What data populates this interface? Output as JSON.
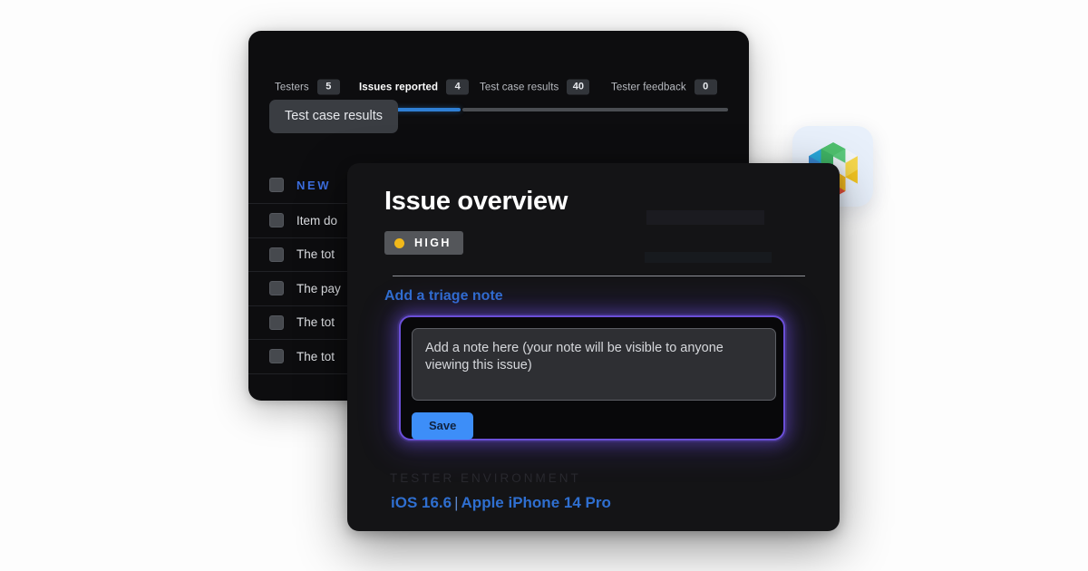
{
  "back_panel": {
    "tabs": [
      {
        "label": "Testers",
        "count": "5",
        "active": false
      },
      {
        "label": "Issues reported",
        "count": "4",
        "active": true
      },
      {
        "label": "Test case results",
        "count": "40",
        "active": false
      },
      {
        "label": "Tester feedback",
        "count": "0",
        "active": false
      }
    ],
    "pill_button": "Test case results",
    "list_header": "NEW",
    "rows": [
      {
        "text": "Item do"
      },
      {
        "text": "The tot"
      },
      {
        "text": "The pay"
      },
      {
        "text": "The tot"
      },
      {
        "text": "The tot"
      }
    ]
  },
  "logo": {
    "icon": "hexagon-cubes-logo",
    "colors": [
      "#3fb264",
      "#2aa7d8",
      "#3a57b8",
      "#6b4aa8",
      "#e8503a",
      "#f2c421",
      "#e9edf2"
    ]
  },
  "modal": {
    "title": "Issue overview",
    "severity": {
      "label": "HIGH",
      "dot_color": "#f1b81a"
    },
    "triage_link": "Add a triage note",
    "note": {
      "placeholder": "Add a note here (your note will be visible to anyone viewing this issue)",
      "value": "",
      "save_label": "Save",
      "glow_color": "#6b4fd8"
    },
    "environment": {
      "label": "TESTER ENVIRONMENT",
      "os": "iOS 16.6",
      "separator": "|",
      "device": "Apple iPhone 14 Pro"
    }
  },
  "theme": {
    "background": "#ffffff",
    "panel_bg": "#0d0d0f",
    "modal_bg": "#141416",
    "accent_blue": "#2f6fd0",
    "save_blue": "#3d8ef8"
  }
}
